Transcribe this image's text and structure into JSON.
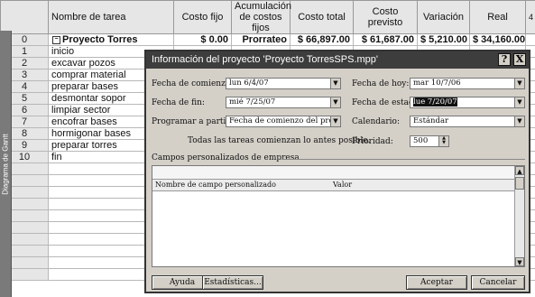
{
  "sheet": {
    "side_label": "Diagrama de Gantt",
    "columns": [
      "Nombre de tarea",
      "Costo fijo",
      "Acumulación de costos fijos",
      "Costo total",
      "Costo previsto",
      "Variación",
      "Real"
    ],
    "column_extra_fragment": "4",
    "rows": [
      {
        "id": "0",
        "name": "Proyecto Torres",
        "fixed": "$ 0.00",
        "accrual": "Prorrateo",
        "total": "$ 66,897.00",
        "baseline": "$ 61,687.00",
        "variance": "$ 5,210.00",
        "actual": "$ 34,160.00",
        "summary": true
      },
      {
        "id": "1",
        "name": "inicio"
      },
      {
        "id": "2",
        "name": "excavar pozos"
      },
      {
        "id": "3",
        "name": "comprar material"
      },
      {
        "id": "4",
        "name": "preparar bases"
      },
      {
        "id": "5",
        "name": "desmontar sopor"
      },
      {
        "id": "6",
        "name": "limpiar sector"
      },
      {
        "id": "7",
        "name": "encofrar bases"
      },
      {
        "id": "8",
        "name": "hormigonar bases"
      },
      {
        "id": "9",
        "name": "preparar torres"
      },
      {
        "id": "10",
        "name": "fin"
      }
    ],
    "empty_rows": 10
  },
  "dialog": {
    "title": "Información del proyecto 'Proyecto TorresSPS.mpp'",
    "help_btn": "?",
    "close_btn": "X",
    "start_date_label": "Fecha de comienzo:",
    "start_date_value": "lun 6/4/07",
    "finish_date_label": "Fecha de fin:",
    "finish_date_value": "mié 7/25/07",
    "schedule_from_label": "Programar a partir de:",
    "schedule_from_value": "Fecha de comienzo del proyecto",
    "schedule_note": "Todas las tareas comienzan lo antes posible.",
    "current_date_label": "Fecha de hoy:",
    "current_date_value": "mar 10/7/06",
    "status_date_label": "Fecha de estado:",
    "status_date_value": "lue 7/20/07",
    "calendar_label": "Calendario:",
    "calendar_value": "Estándar",
    "priority_label": "Prioridad:",
    "priority_value": "500",
    "custom_fields_label": "Campos personalizados de empresa",
    "custom_col_name": "Nombre de campo personalizado",
    "custom_col_value": "Valor",
    "help_button": "Ayuda",
    "stats_button": "Estadísticas...",
    "ok_button": "Aceptar",
    "cancel_button": "Cancelar"
  }
}
